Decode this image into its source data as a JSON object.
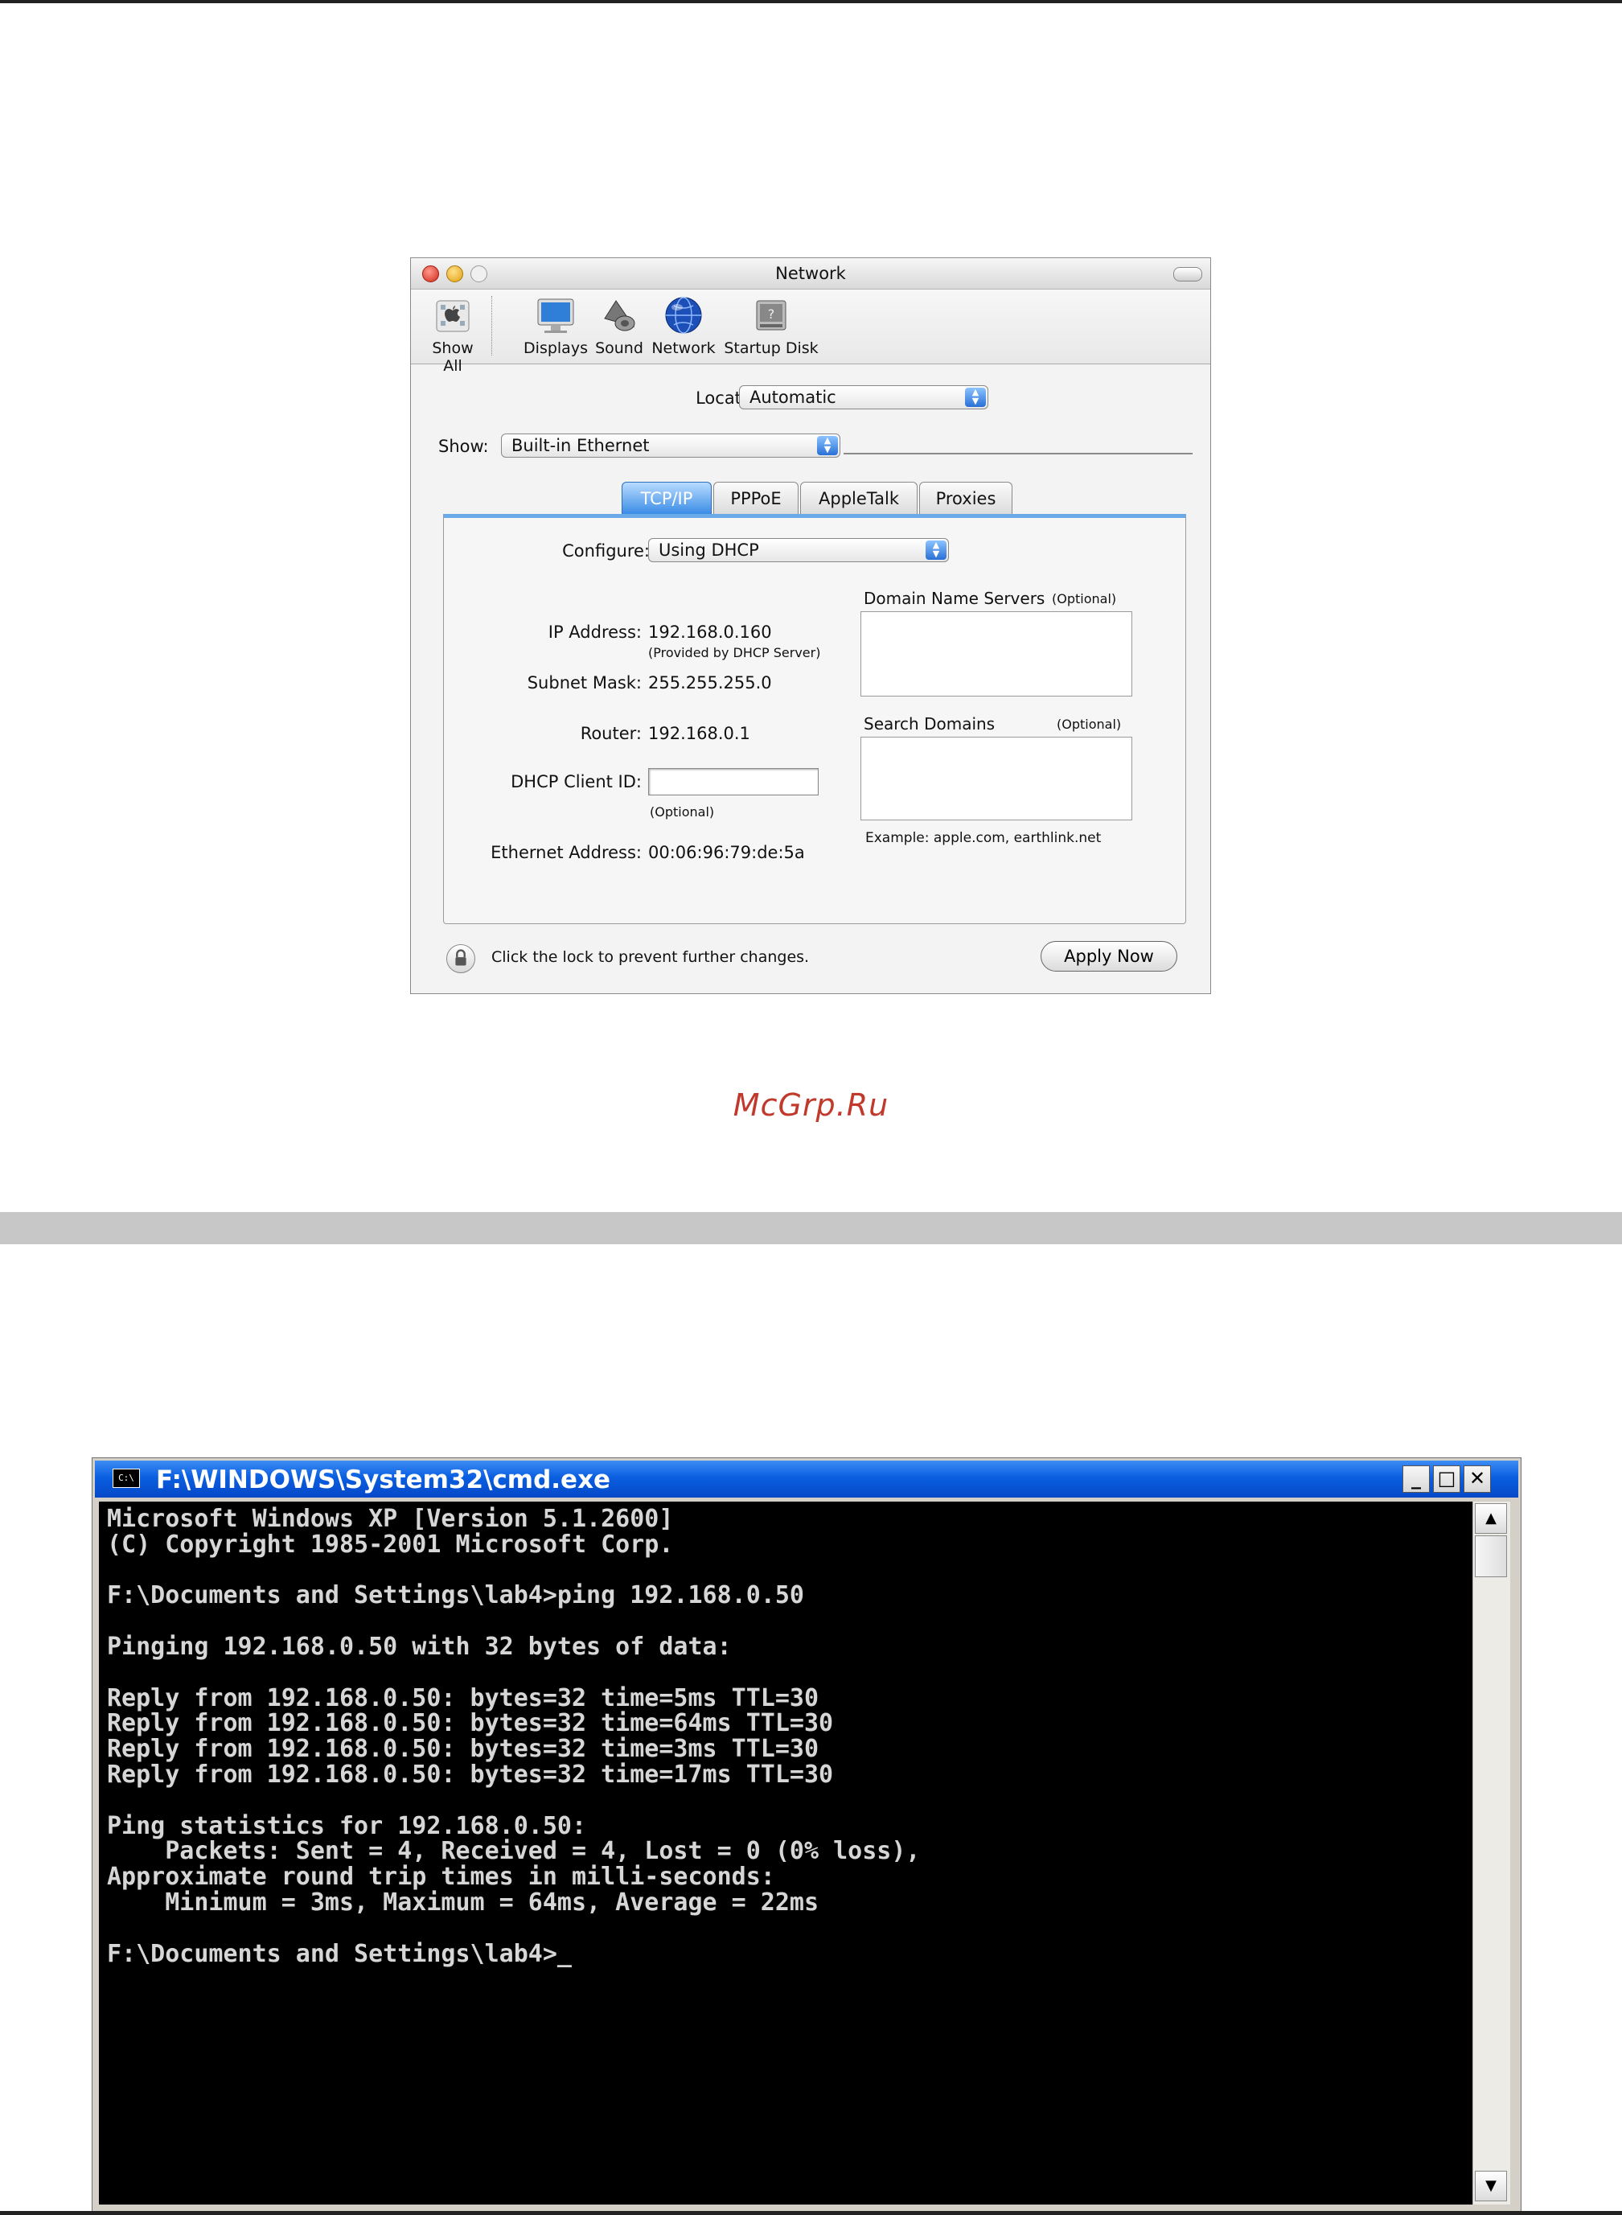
{
  "watermark": "McGrp.Ru",
  "mac_network": {
    "window_title": "Network",
    "toolbar": [
      {
        "label": "Show All",
        "icon": "apple-icon"
      },
      {
        "label": "Displays",
        "icon": "display-icon"
      },
      {
        "label": "Sound",
        "icon": "speaker-icon"
      },
      {
        "label": "Network",
        "icon": "globe-icon"
      },
      {
        "label": "Startup Disk",
        "icon": "disk-icon"
      }
    ],
    "location": {
      "label": "Location:",
      "value": "Automatic"
    },
    "show": {
      "label": "Show:",
      "value": "Built-in Ethernet"
    },
    "tabs": [
      {
        "label": "TCP/IP",
        "active": true
      },
      {
        "label": "PPPoE",
        "active": false
      },
      {
        "label": "AppleTalk",
        "active": false
      },
      {
        "label": "Proxies",
        "active": false
      }
    ],
    "configure": {
      "label": "Configure:",
      "value": "Using DHCP"
    },
    "ip_address": {
      "label": "IP Address:",
      "value": "192.168.0.160",
      "note": "(Provided by DHCP Server)"
    },
    "subnet_mask": {
      "label": "Subnet Mask:",
      "value": "255.255.255.0"
    },
    "router": {
      "label": "Router:",
      "value": "192.168.0.1"
    },
    "dhcp_client_id": {
      "label": "DHCP Client ID:",
      "value": "",
      "note": "(Optional)"
    },
    "ethernet_address": {
      "label": "Ethernet Address:",
      "value": "00:06:96:79:de:5a"
    },
    "dns": {
      "label": "Domain Name Servers",
      "optional": "(Optional)"
    },
    "search_domains": {
      "label": "Search Domains",
      "optional": "(Optional)",
      "example": "Example: apple.com, earthlink.net"
    },
    "lock_text": "Click the lock to prevent further changes.",
    "apply_button": "Apply Now"
  },
  "cmd": {
    "window_title": "F:\\WINDOWS\\System32\\cmd.exe",
    "icon_text": "C:\\",
    "buttons": {
      "minimize": "_",
      "maximize": "□",
      "close": "✕"
    },
    "scroll_up": "▲",
    "scroll_down": "▼",
    "console_text": "Microsoft Windows XP [Version 5.1.2600]\n(C) Copyright 1985-2001 Microsoft Corp.\n\nF:\\Documents and Settings\\lab4>ping 192.168.0.50\n\nPinging 192.168.0.50 with 32 bytes of data:\n\nReply from 192.168.0.50: bytes=32 time=5ms TTL=30\nReply from 192.168.0.50: bytes=32 time=64ms TTL=30\nReply from 192.168.0.50: bytes=32 time=3ms TTL=30\nReply from 192.168.0.50: bytes=32 time=17ms TTL=30\n\nPing statistics for 192.168.0.50:\n    Packets: Sent = 4, Received = 4, Lost = 0 (0% loss),\nApproximate round trip times in milli-seconds:\n    Minimum = 3ms, Maximum = 64ms, Average = 22ms\n\nF:\\Documents and Settings\\lab4>_"
  }
}
